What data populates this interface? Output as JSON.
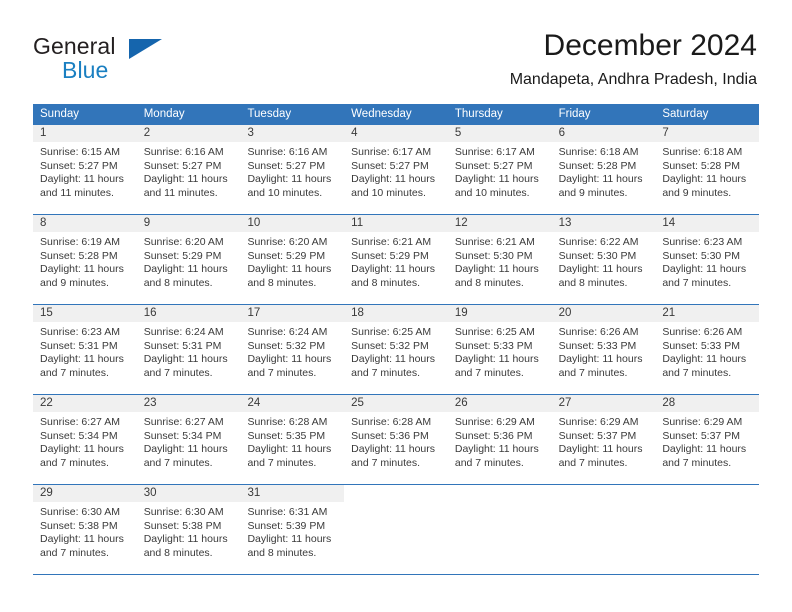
{
  "brand": {
    "line1": "General",
    "line2": "Blue",
    "flag_icon": "brand-flag-icon"
  },
  "header": {
    "title": "December 2024",
    "subtitle": "Mandapeta, Andhra Pradesh, India"
  },
  "colors": {
    "header_blue": "#3275ba",
    "brand_dark": "#231f20",
    "brand_blue": "#1a7fc1",
    "daynum_bg": "#f0f0f0",
    "text": "#3a3a3a"
  },
  "weekdays": [
    "Sunday",
    "Monday",
    "Tuesday",
    "Wednesday",
    "Thursday",
    "Friday",
    "Saturday"
  ],
  "weeks": [
    [
      {
        "day": "1",
        "sunrise": "Sunrise: 6:15 AM",
        "sunset": "Sunset: 5:27 PM",
        "daylight1": "Daylight: 11 hours",
        "daylight2": "and 11 minutes."
      },
      {
        "day": "2",
        "sunrise": "Sunrise: 6:16 AM",
        "sunset": "Sunset: 5:27 PM",
        "daylight1": "Daylight: 11 hours",
        "daylight2": "and 11 minutes."
      },
      {
        "day": "3",
        "sunrise": "Sunrise: 6:16 AM",
        "sunset": "Sunset: 5:27 PM",
        "daylight1": "Daylight: 11 hours",
        "daylight2": "and 10 minutes."
      },
      {
        "day": "4",
        "sunrise": "Sunrise: 6:17 AM",
        "sunset": "Sunset: 5:27 PM",
        "daylight1": "Daylight: 11 hours",
        "daylight2": "and 10 minutes."
      },
      {
        "day": "5",
        "sunrise": "Sunrise: 6:17 AM",
        "sunset": "Sunset: 5:27 PM",
        "daylight1": "Daylight: 11 hours",
        "daylight2": "and 10 minutes."
      },
      {
        "day": "6",
        "sunrise": "Sunrise: 6:18 AM",
        "sunset": "Sunset: 5:28 PM",
        "daylight1": "Daylight: 11 hours",
        "daylight2": "and 9 minutes."
      },
      {
        "day": "7",
        "sunrise": "Sunrise: 6:18 AM",
        "sunset": "Sunset: 5:28 PM",
        "daylight1": "Daylight: 11 hours",
        "daylight2": "and 9 minutes."
      }
    ],
    [
      {
        "day": "8",
        "sunrise": "Sunrise: 6:19 AM",
        "sunset": "Sunset: 5:28 PM",
        "daylight1": "Daylight: 11 hours",
        "daylight2": "and 9 minutes."
      },
      {
        "day": "9",
        "sunrise": "Sunrise: 6:20 AM",
        "sunset": "Sunset: 5:29 PM",
        "daylight1": "Daylight: 11 hours",
        "daylight2": "and 8 minutes."
      },
      {
        "day": "10",
        "sunrise": "Sunrise: 6:20 AM",
        "sunset": "Sunset: 5:29 PM",
        "daylight1": "Daylight: 11 hours",
        "daylight2": "and 8 minutes."
      },
      {
        "day": "11",
        "sunrise": "Sunrise: 6:21 AM",
        "sunset": "Sunset: 5:29 PM",
        "daylight1": "Daylight: 11 hours",
        "daylight2": "and 8 minutes."
      },
      {
        "day": "12",
        "sunrise": "Sunrise: 6:21 AM",
        "sunset": "Sunset: 5:30 PM",
        "daylight1": "Daylight: 11 hours",
        "daylight2": "and 8 minutes."
      },
      {
        "day": "13",
        "sunrise": "Sunrise: 6:22 AM",
        "sunset": "Sunset: 5:30 PM",
        "daylight1": "Daylight: 11 hours",
        "daylight2": "and 8 minutes."
      },
      {
        "day": "14",
        "sunrise": "Sunrise: 6:23 AM",
        "sunset": "Sunset: 5:30 PM",
        "daylight1": "Daylight: 11 hours",
        "daylight2": "and 7 minutes."
      }
    ],
    [
      {
        "day": "15",
        "sunrise": "Sunrise: 6:23 AM",
        "sunset": "Sunset: 5:31 PM",
        "daylight1": "Daylight: 11 hours",
        "daylight2": "and 7 minutes."
      },
      {
        "day": "16",
        "sunrise": "Sunrise: 6:24 AM",
        "sunset": "Sunset: 5:31 PM",
        "daylight1": "Daylight: 11 hours",
        "daylight2": "and 7 minutes."
      },
      {
        "day": "17",
        "sunrise": "Sunrise: 6:24 AM",
        "sunset": "Sunset: 5:32 PM",
        "daylight1": "Daylight: 11 hours",
        "daylight2": "and 7 minutes."
      },
      {
        "day": "18",
        "sunrise": "Sunrise: 6:25 AM",
        "sunset": "Sunset: 5:32 PM",
        "daylight1": "Daylight: 11 hours",
        "daylight2": "and 7 minutes."
      },
      {
        "day": "19",
        "sunrise": "Sunrise: 6:25 AM",
        "sunset": "Sunset: 5:33 PM",
        "daylight1": "Daylight: 11 hours",
        "daylight2": "and 7 minutes."
      },
      {
        "day": "20",
        "sunrise": "Sunrise: 6:26 AM",
        "sunset": "Sunset: 5:33 PM",
        "daylight1": "Daylight: 11 hours",
        "daylight2": "and 7 minutes."
      },
      {
        "day": "21",
        "sunrise": "Sunrise: 6:26 AM",
        "sunset": "Sunset: 5:33 PM",
        "daylight1": "Daylight: 11 hours",
        "daylight2": "and 7 minutes."
      }
    ],
    [
      {
        "day": "22",
        "sunrise": "Sunrise: 6:27 AM",
        "sunset": "Sunset: 5:34 PM",
        "daylight1": "Daylight: 11 hours",
        "daylight2": "and 7 minutes."
      },
      {
        "day": "23",
        "sunrise": "Sunrise: 6:27 AM",
        "sunset": "Sunset: 5:34 PM",
        "daylight1": "Daylight: 11 hours",
        "daylight2": "and 7 minutes."
      },
      {
        "day": "24",
        "sunrise": "Sunrise: 6:28 AM",
        "sunset": "Sunset: 5:35 PM",
        "daylight1": "Daylight: 11 hours",
        "daylight2": "and 7 minutes."
      },
      {
        "day": "25",
        "sunrise": "Sunrise: 6:28 AM",
        "sunset": "Sunset: 5:36 PM",
        "daylight1": "Daylight: 11 hours",
        "daylight2": "and 7 minutes."
      },
      {
        "day": "26",
        "sunrise": "Sunrise: 6:29 AM",
        "sunset": "Sunset: 5:36 PM",
        "daylight1": "Daylight: 11 hours",
        "daylight2": "and 7 minutes."
      },
      {
        "day": "27",
        "sunrise": "Sunrise: 6:29 AM",
        "sunset": "Sunset: 5:37 PM",
        "daylight1": "Daylight: 11 hours",
        "daylight2": "and 7 minutes."
      },
      {
        "day": "28",
        "sunrise": "Sunrise: 6:29 AM",
        "sunset": "Sunset: 5:37 PM",
        "daylight1": "Daylight: 11 hours",
        "daylight2": "and 7 minutes."
      }
    ],
    [
      {
        "day": "29",
        "sunrise": "Sunrise: 6:30 AM",
        "sunset": "Sunset: 5:38 PM",
        "daylight1": "Daylight: 11 hours",
        "daylight2": "and 7 minutes."
      },
      {
        "day": "30",
        "sunrise": "Sunrise: 6:30 AM",
        "sunset": "Sunset: 5:38 PM",
        "daylight1": "Daylight: 11 hours",
        "daylight2": "and 8 minutes."
      },
      {
        "day": "31",
        "sunrise": "Sunrise: 6:31 AM",
        "sunset": "Sunset: 5:39 PM",
        "daylight1": "Daylight: 11 hours",
        "daylight2": "and 8 minutes."
      },
      {
        "day": "",
        "sunrise": "",
        "sunset": "",
        "daylight1": "",
        "daylight2": ""
      },
      {
        "day": "",
        "sunrise": "",
        "sunset": "",
        "daylight1": "",
        "daylight2": ""
      },
      {
        "day": "",
        "sunrise": "",
        "sunset": "",
        "daylight1": "",
        "daylight2": ""
      },
      {
        "day": "",
        "sunrise": "",
        "sunset": "",
        "daylight1": "",
        "daylight2": ""
      }
    ]
  ]
}
